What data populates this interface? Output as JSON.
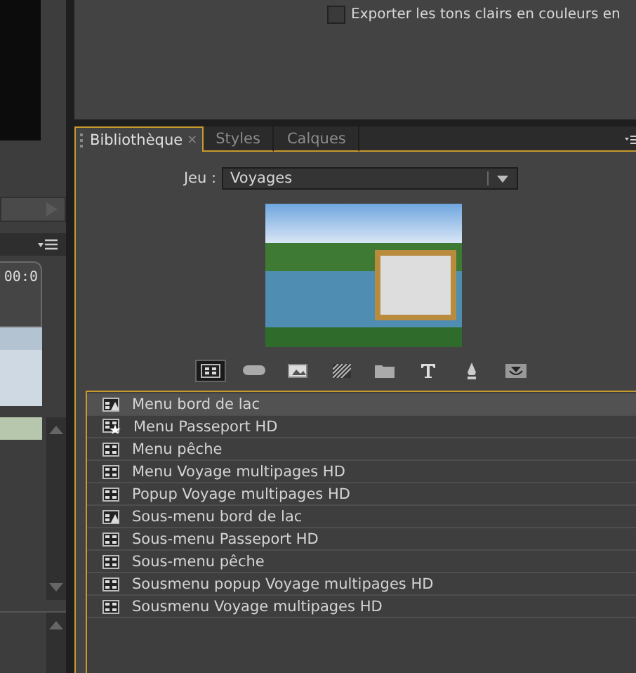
{
  "export_option": {
    "label": "Exporter les tons clairs en couleurs en",
    "checked": false
  },
  "left_panel": {
    "timecode": "00:0"
  },
  "tabs": [
    {
      "label": "Bibliothèque",
      "selected": true,
      "close": "×"
    },
    {
      "label": "Styles",
      "selected": false
    },
    {
      "label": "Calques",
      "selected": false
    }
  ],
  "set": {
    "label": "Jeu :",
    "value": "Voyages"
  },
  "categories": [
    {
      "kind": "menu",
      "selected": true
    },
    {
      "kind": "button",
      "selected": false
    },
    {
      "kind": "image",
      "selected": false
    },
    {
      "kind": "pattern",
      "selected": false
    },
    {
      "kind": "folder",
      "selected": false
    },
    {
      "kind": "text",
      "selected": false
    },
    {
      "kind": "pen",
      "selected": false
    },
    {
      "kind": "download",
      "selected": false
    }
  ],
  "items": [
    {
      "label": "Menu bord de lac",
      "kind": "motion",
      "selected": true
    },
    {
      "label": "Menu Passeport HD",
      "kind": "favorite",
      "selected": false
    },
    {
      "label": "Menu pêche",
      "kind": "plain",
      "selected": false
    },
    {
      "label": "Menu Voyage multipages HD",
      "kind": "plain",
      "selected": false
    },
    {
      "label": "Popup Voyage multipages HD",
      "kind": "plain",
      "selected": false
    },
    {
      "label": "Sous-menu bord de lac",
      "kind": "motion",
      "selected": false
    },
    {
      "label": "Sous-menu Passeport HD",
      "kind": "plain",
      "selected": false
    },
    {
      "label": "Sous-menu pêche",
      "kind": "plain",
      "selected": false
    },
    {
      "label": "Sousmenu popup Voyage multipages HD",
      "kind": "plain",
      "selected": false
    },
    {
      "label": "Sousmenu Voyage multipages HD",
      "kind": "plain",
      "selected": false
    }
  ]
}
